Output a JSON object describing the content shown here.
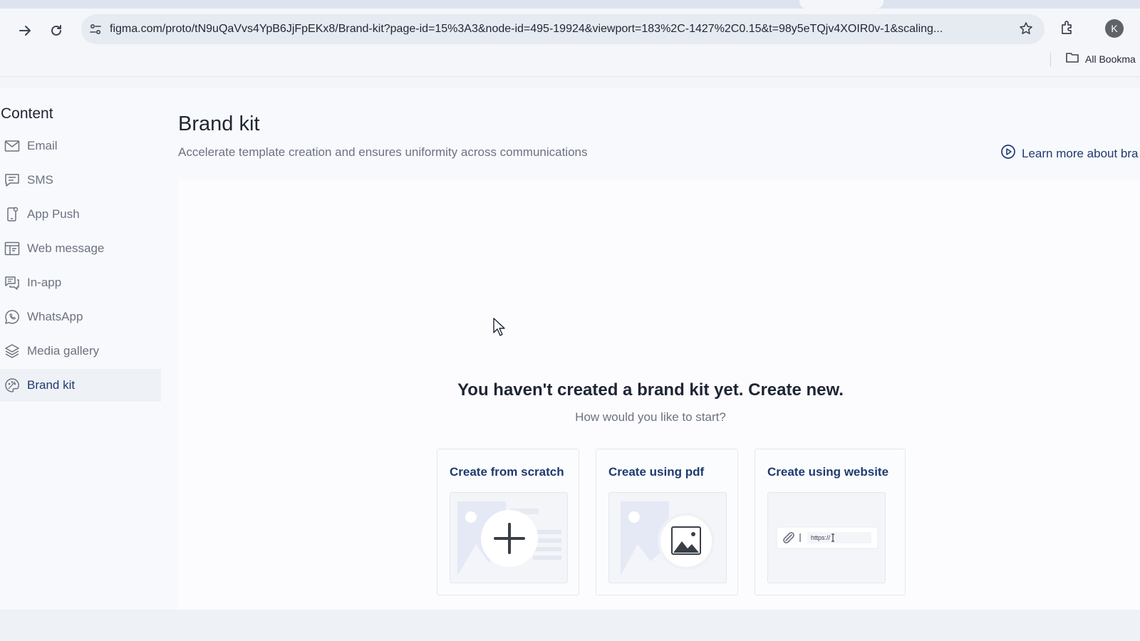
{
  "browser": {
    "url": "figma.com/proto/tN9uQaVvs4YpB6JjFpEKx8/Brand-kit?page-id=15%3A3&node-id=495-19924&viewport=183%2C-1427%2C0.15&t=98y5eTQjv4XOIR0v-1&scaling...",
    "avatar_letter": "K",
    "bookmarks_label": "All Bookma",
    "icons": [
      "forward-icon",
      "reload-icon",
      "site-settings-icon",
      "star-icon",
      "extensions-icon",
      "folder-icon"
    ]
  },
  "sidebar": {
    "title": "Content",
    "items": [
      {
        "label": "Email",
        "icon": "mail-icon"
      },
      {
        "label": "SMS",
        "icon": "chat-icon"
      },
      {
        "label": "App Push",
        "icon": "phone-icon"
      },
      {
        "label": "Web message",
        "icon": "web-message-icon"
      },
      {
        "label": "In-app",
        "icon": "in-app-icon"
      },
      {
        "label": "WhatsApp",
        "icon": "whatsapp-icon"
      },
      {
        "label": "Media gallery",
        "icon": "layers-icon"
      },
      {
        "label": "Brand kit",
        "icon": "palette-icon",
        "active": true
      }
    ]
  },
  "main": {
    "title": "Brand kit",
    "subtitle": "Accelerate template creation and ensures uniformity across communications",
    "learn_more": "Learn more about bra",
    "empty_title": "You haven't created a brand kit yet. Create new.",
    "empty_subtitle": "How would you like to start?",
    "options": [
      {
        "label": "Create from scratch"
      },
      {
        "label": "Create using pdf"
      },
      {
        "label": "Create using website",
        "url_placeholder": "https://"
      }
    ]
  },
  "colors": {
    "accent": "#1f3a6e",
    "muted_text": "#6b7280",
    "background": "#f8f9fc"
  }
}
